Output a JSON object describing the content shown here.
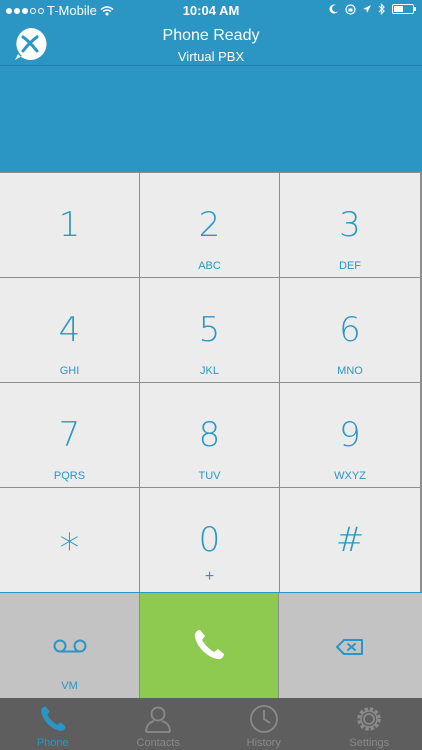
{
  "status_bar": {
    "carrier": "T-Mobile",
    "time": "10:04 AM",
    "battery_level": 0.5
  },
  "header": {
    "title": "Phone Ready",
    "subtitle": "Virtual PBX"
  },
  "keypad": {
    "keys": [
      {
        "digit": "1",
        "letters": ""
      },
      {
        "digit": "2",
        "letters": "ABC"
      },
      {
        "digit": "3",
        "letters": "DEF"
      },
      {
        "digit": "4",
        "letters": "GHI"
      },
      {
        "digit": "5",
        "letters": "JKL"
      },
      {
        "digit": "6",
        "letters": "MNO"
      },
      {
        "digit": "7",
        "letters": "PQRS"
      },
      {
        "digit": "8",
        "letters": "TUV"
      },
      {
        "digit": "9",
        "letters": "WXYZ"
      },
      {
        "digit": "*",
        "letters": ""
      },
      {
        "digit": "0",
        "letters": "+"
      },
      {
        "digit": "#",
        "letters": ""
      }
    ],
    "vm_label": "VM"
  },
  "tabs": [
    {
      "label": "Phone",
      "icon": "phone-icon",
      "active": true
    },
    {
      "label": "Contacts",
      "icon": "contacts-icon",
      "active": false
    },
    {
      "label": "History",
      "icon": "clock-icon",
      "active": false
    },
    {
      "label": "Settings",
      "icon": "gear-icon",
      "active": false
    }
  ],
  "colors": {
    "brand_blue": "#2b96c4",
    "call_green": "#8ec950",
    "tab_bar": "#5e5e5e"
  }
}
